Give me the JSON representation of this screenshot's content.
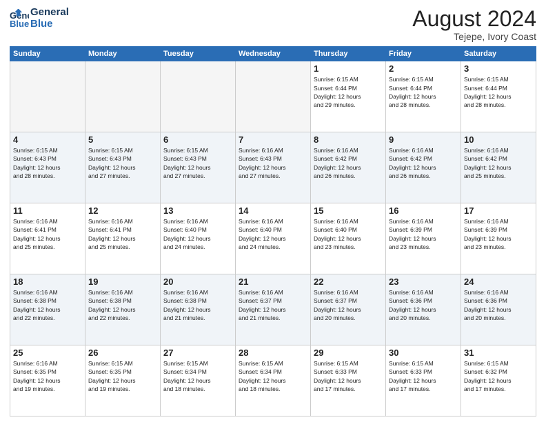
{
  "logo": {
    "line1": "General",
    "line2": "Blue"
  },
  "title": "August 2024",
  "location": "Tejepe, Ivory Coast",
  "weekdays": [
    "Sunday",
    "Monday",
    "Tuesday",
    "Wednesday",
    "Thursday",
    "Friday",
    "Saturday"
  ],
  "weeks": [
    [
      {
        "day": "",
        "info": ""
      },
      {
        "day": "",
        "info": ""
      },
      {
        "day": "",
        "info": ""
      },
      {
        "day": "",
        "info": ""
      },
      {
        "day": "1",
        "info": "Sunrise: 6:15 AM\nSunset: 6:44 PM\nDaylight: 12 hours\nand 29 minutes."
      },
      {
        "day": "2",
        "info": "Sunrise: 6:15 AM\nSunset: 6:44 PM\nDaylight: 12 hours\nand 28 minutes."
      },
      {
        "day": "3",
        "info": "Sunrise: 6:15 AM\nSunset: 6:44 PM\nDaylight: 12 hours\nand 28 minutes."
      }
    ],
    [
      {
        "day": "4",
        "info": "Sunrise: 6:15 AM\nSunset: 6:43 PM\nDaylight: 12 hours\nand 28 minutes."
      },
      {
        "day": "5",
        "info": "Sunrise: 6:15 AM\nSunset: 6:43 PM\nDaylight: 12 hours\nand 27 minutes."
      },
      {
        "day": "6",
        "info": "Sunrise: 6:15 AM\nSunset: 6:43 PM\nDaylight: 12 hours\nand 27 minutes."
      },
      {
        "day": "7",
        "info": "Sunrise: 6:16 AM\nSunset: 6:43 PM\nDaylight: 12 hours\nand 27 minutes."
      },
      {
        "day": "8",
        "info": "Sunrise: 6:16 AM\nSunset: 6:42 PM\nDaylight: 12 hours\nand 26 minutes."
      },
      {
        "day": "9",
        "info": "Sunrise: 6:16 AM\nSunset: 6:42 PM\nDaylight: 12 hours\nand 26 minutes."
      },
      {
        "day": "10",
        "info": "Sunrise: 6:16 AM\nSunset: 6:42 PM\nDaylight: 12 hours\nand 25 minutes."
      }
    ],
    [
      {
        "day": "11",
        "info": "Sunrise: 6:16 AM\nSunset: 6:41 PM\nDaylight: 12 hours\nand 25 minutes."
      },
      {
        "day": "12",
        "info": "Sunrise: 6:16 AM\nSunset: 6:41 PM\nDaylight: 12 hours\nand 25 minutes."
      },
      {
        "day": "13",
        "info": "Sunrise: 6:16 AM\nSunset: 6:40 PM\nDaylight: 12 hours\nand 24 minutes."
      },
      {
        "day": "14",
        "info": "Sunrise: 6:16 AM\nSunset: 6:40 PM\nDaylight: 12 hours\nand 24 minutes."
      },
      {
        "day": "15",
        "info": "Sunrise: 6:16 AM\nSunset: 6:40 PM\nDaylight: 12 hours\nand 23 minutes."
      },
      {
        "day": "16",
        "info": "Sunrise: 6:16 AM\nSunset: 6:39 PM\nDaylight: 12 hours\nand 23 minutes."
      },
      {
        "day": "17",
        "info": "Sunrise: 6:16 AM\nSunset: 6:39 PM\nDaylight: 12 hours\nand 23 minutes."
      }
    ],
    [
      {
        "day": "18",
        "info": "Sunrise: 6:16 AM\nSunset: 6:38 PM\nDaylight: 12 hours\nand 22 minutes."
      },
      {
        "day": "19",
        "info": "Sunrise: 6:16 AM\nSunset: 6:38 PM\nDaylight: 12 hours\nand 22 minutes."
      },
      {
        "day": "20",
        "info": "Sunrise: 6:16 AM\nSunset: 6:38 PM\nDaylight: 12 hours\nand 21 minutes."
      },
      {
        "day": "21",
        "info": "Sunrise: 6:16 AM\nSunset: 6:37 PM\nDaylight: 12 hours\nand 21 minutes."
      },
      {
        "day": "22",
        "info": "Sunrise: 6:16 AM\nSunset: 6:37 PM\nDaylight: 12 hours\nand 20 minutes."
      },
      {
        "day": "23",
        "info": "Sunrise: 6:16 AM\nSunset: 6:36 PM\nDaylight: 12 hours\nand 20 minutes."
      },
      {
        "day": "24",
        "info": "Sunrise: 6:16 AM\nSunset: 6:36 PM\nDaylight: 12 hours\nand 20 minutes."
      }
    ],
    [
      {
        "day": "25",
        "info": "Sunrise: 6:16 AM\nSunset: 6:35 PM\nDaylight: 12 hours\nand 19 minutes."
      },
      {
        "day": "26",
        "info": "Sunrise: 6:15 AM\nSunset: 6:35 PM\nDaylight: 12 hours\nand 19 minutes."
      },
      {
        "day": "27",
        "info": "Sunrise: 6:15 AM\nSunset: 6:34 PM\nDaylight: 12 hours\nand 18 minutes."
      },
      {
        "day": "28",
        "info": "Sunrise: 6:15 AM\nSunset: 6:34 PM\nDaylight: 12 hours\nand 18 minutes."
      },
      {
        "day": "29",
        "info": "Sunrise: 6:15 AM\nSunset: 6:33 PM\nDaylight: 12 hours\nand 17 minutes."
      },
      {
        "day": "30",
        "info": "Sunrise: 6:15 AM\nSunset: 6:33 PM\nDaylight: 12 hours\nand 17 minutes."
      },
      {
        "day": "31",
        "info": "Sunrise: 6:15 AM\nSunset: 6:32 PM\nDaylight: 12 hours\nand 17 minutes."
      }
    ]
  ]
}
